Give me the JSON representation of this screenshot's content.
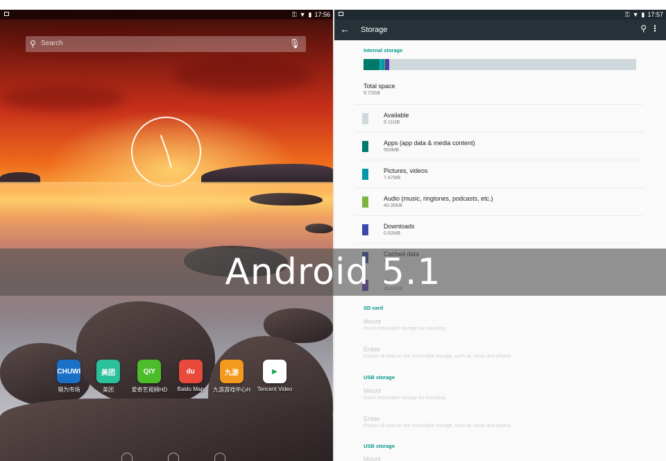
{
  "home": {
    "status_time": "17:56",
    "search_placeholder": "Search",
    "apps": [
      {
        "label": "猎为市场",
        "icon_text": "CHUWI",
        "color": "#1a6fc7",
        "icon": "chuwi-market-icon"
      },
      {
        "label": "美团",
        "icon_text": "美团",
        "color": "#2bbf9a",
        "icon": "meituan-icon"
      },
      {
        "label": "爱奇艺视频HD",
        "icon_text": "QIY",
        "color": "#4cbc2a",
        "icon": "iqiyi-icon"
      },
      {
        "label": "Baidu Map",
        "icon_text": "du",
        "color": "#e84a3b",
        "icon": "baidu-map-icon"
      },
      {
        "label": "九游游戏中心H",
        "icon_text": "九游",
        "color": "#f39a1e",
        "icon": "jiuyou-icon"
      },
      {
        "label": "Tencent Video",
        "icon_text": "▶",
        "color": "#ffffff",
        "icon": "tencent-video-icon"
      }
    ]
  },
  "storage": {
    "status_time": "17:57",
    "title": "Storage",
    "internal_header": "Internal storage",
    "bar_segments": [
      {
        "color": "#00796b",
        "fraction": 0.058
      },
      {
        "color": "#26a69a",
        "fraction": 0.008
      },
      {
        "color": "#0097a7",
        "fraction": 0.01
      },
      {
        "color": "#7cb342",
        "fraction": 0.004
      },
      {
        "color": "#3949ab",
        "fraction": 0.006
      },
      {
        "color": "#5e35b1",
        "fraction": 0.008
      }
    ],
    "total_label": "Total space",
    "total_value": "9.72GB",
    "items": [
      {
        "title": "Available",
        "value": "9.11GB",
        "color": "#cfd8dc"
      },
      {
        "title": "Apps (app data & media content)",
        "value": "563MB",
        "color": "#00796b"
      },
      {
        "title": "Pictures, videos",
        "value": "7.47MB",
        "color": "#0097a7"
      },
      {
        "title": "Audio (music, ringtones, podcasts, etc.)",
        "value": "40.00KB",
        "color": "#7cb342"
      },
      {
        "title": "Downloads",
        "value": "0.92MB",
        "color": "#3949ab"
      },
      {
        "title": "Cached data",
        "value": "12...",
        "color": "#303f9f"
      },
      {
        "title": "M...",
        "value": "20.02KB",
        "color": "#5e35b1"
      }
    ],
    "sd_header": "SD card",
    "sd_mount": "Mount",
    "sd_mount_sub": "Insert removable storage for mounting",
    "sd_erase": "Erase",
    "sd_erase_sub": "Erases all data on the removable storage, such as music and photos",
    "usb_header": "USB storage",
    "usb_mount": "Mount",
    "usb_mount_sub": "Insert removable storage for mounting",
    "usb_erase": "Erase",
    "usb_erase_sub": "Erases all data on the removable storage, such as music and photos",
    "usb2_header": "USB storage",
    "usb2_mount": "Mount"
  },
  "banner": {
    "text": "Android 5.1"
  }
}
